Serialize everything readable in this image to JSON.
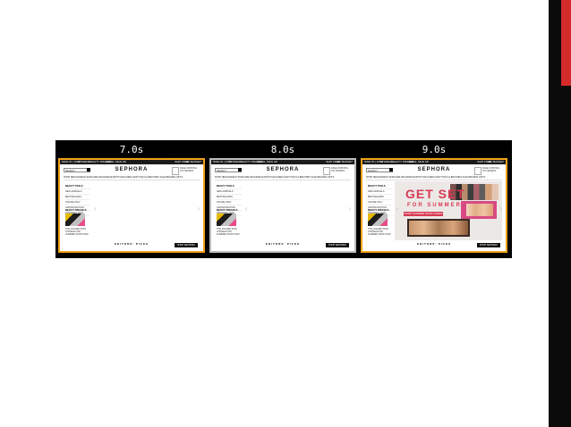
{
  "frames": [
    {
      "time_label": "7.0s",
      "style": "orange",
      "state": "loading"
    },
    {
      "time_label": "8.0s",
      "style": "plain",
      "state": "loading"
    },
    {
      "time_label": "9.0s",
      "style": "orange",
      "state": "loaded"
    }
  ],
  "site": {
    "logo": "SEPHORA",
    "nav_items": [
      "SIGN IN | JOIN",
      "STORES",
      "BEAUTY INSIDER",
      "EMAIL SIGN UP",
      "MY BASKET",
      "SHIP FREE"
    ],
    "search_placeholder": "SEARCH",
    "promo_text": "FREE SHIPPING ON ORDERS",
    "categories": "SHOP  NEW  MAKEUP  SKINCARE  FRAGRANCE  BATH  NAILS  MEN  HAIR  TOOLS & BRUSHES  SALE  BRANDS  GIFTS",
    "sidebar_header": "BEAUTY TOOLS",
    "sidebar_items": [
      "NEW ARRIVALS",
      "BESTSELLERS",
      "ONLINE ONLY",
      "LIMITED EDITION",
      "TRENDING NOW"
    ],
    "product_header": "BEAUTY SPECIALS",
    "product_text": "THE GOLDEN FIND CHOSEN FOR SUMMER SHOP NOW",
    "editors_picks": "EDITORS' PICKS",
    "shop_button": "SHOP SEPHORA PICKS",
    "hero_line1": "GET SET",
    "hero_line2": "FOR SUMMER",
    "hero_cta": "SHOP SUMMER MUST-HAVES"
  },
  "colors": {
    "accent": "#f1a21a",
    "brand_pink": "#d83a54",
    "edge_red": "#d42a2a"
  }
}
